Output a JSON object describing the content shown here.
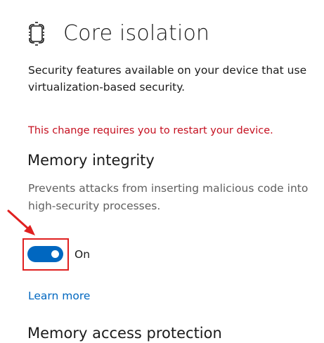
{
  "header": {
    "icon": "chip-frame-icon",
    "title": "Core isolation"
  },
  "intro": {
    "description": "Security features available on your device that use virtualization-based security."
  },
  "warning": {
    "text": "This change requires you to restart your device.",
    "color": "#c50f1f"
  },
  "memory_integrity": {
    "title": "Memory integrity",
    "description": "Prevents attacks from inserting malicious code into high-security processes.",
    "toggle": {
      "state": true,
      "label": "On",
      "accent_color": "#0067c0"
    },
    "learn_more": "Learn more"
  },
  "memory_access_protection": {
    "title": "Memory access protection"
  },
  "annotation": {
    "highlight_color": "#e02020",
    "arrow_icon": "red-arrow-icon"
  }
}
